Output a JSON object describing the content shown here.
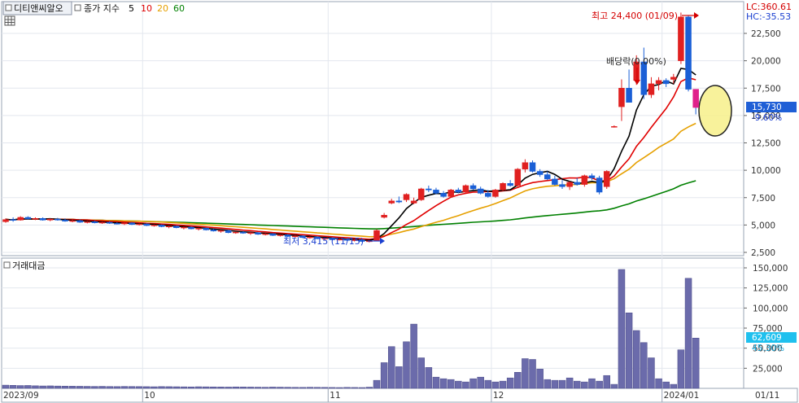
{
  "header": {
    "stock_name": "디티앤씨알오",
    "legend_prefix": "종가 지수",
    "ma_periods": [
      {
        "label": "5",
        "color": "#000000"
      },
      {
        "label": "10",
        "color": "#e00000"
      },
      {
        "label": "20",
        "color": "#e6a000"
      },
      {
        "label": "60",
        "color": "#008000"
      }
    ],
    "lc_text": "LC:360.61",
    "hc_text": "HC:-35.53",
    "volume_panel_title": "거래대금"
  },
  "chart_data": {
    "type": "candlestick",
    "price_panel": {
      "yticks": [
        "22,500",
        "20,000",
        "17,500",
        "15,000",
        "12,500",
        "10,000",
        "7,500",
        "5,000",
        "2,500"
      ],
      "ylim": [
        1500,
        26000
      ],
      "last_price_label": "15,730",
      "last_change_label": "-9.60%",
      "annotations": {
        "high": "최고 24,400 (01/09)",
        "low": "최저 3,415 (11/15)",
        "dividend": "배당락(0.00%)"
      },
      "candles": [
        [
          5300,
          5600,
          5200,
          5500
        ],
        [
          5500,
          5700,
          5300,
          5450
        ],
        [
          5450,
          5800,
          5400,
          5700
        ],
        [
          5700,
          5800,
          5500,
          5550
        ],
        [
          5550,
          5700,
          5450,
          5600
        ],
        [
          5600,
          5700,
          5400,
          5450
        ],
        [
          5450,
          5600,
          5350,
          5550
        ],
        [
          5550,
          5650,
          5400,
          5450
        ],
        [
          5450,
          5600,
          5300,
          5350
        ],
        [
          5350,
          5500,
          5250,
          5400
        ],
        [
          5400,
          5500,
          5200,
          5250
        ],
        [
          5250,
          5350,
          5150,
          5300
        ],
        [
          5300,
          5400,
          5150,
          5200
        ],
        [
          5200,
          5300,
          5100,
          5250
        ],
        [
          5250,
          5350,
          5100,
          5150
        ],
        [
          5150,
          5250,
          5050,
          5100
        ],
        [
          5100,
          5250,
          5000,
          5200
        ],
        [
          5200,
          5250,
          5000,
          5050
        ],
        [
          5050,
          5150,
          4950,
          5100
        ],
        [
          5100,
          5150,
          4900,
          4950
        ],
        [
          4950,
          5050,
          4850,
          5000
        ],
        [
          5000,
          5050,
          4800,
          4850
        ],
        [
          4850,
          4950,
          4700,
          4900
        ],
        [
          4900,
          4950,
          4700,
          4750
        ],
        [
          4750,
          4850,
          4600,
          4800
        ],
        [
          4800,
          4850,
          4600,
          4650
        ],
        [
          4650,
          4750,
          4500,
          4700
        ],
        [
          4700,
          4750,
          4500,
          4550
        ],
        [
          4550,
          4650,
          4400,
          4450
        ],
        [
          4450,
          4550,
          4300,
          4500
        ],
        [
          4500,
          4550,
          4250,
          4300
        ],
        [
          4300,
          4400,
          4200,
          4350
        ],
        [
          4350,
          4450,
          4200,
          4250
        ],
        [
          4250,
          4350,
          4100,
          4300
        ],
        [
          4300,
          4350,
          4100,
          4150
        ],
        [
          4150,
          4250,
          4050,
          4200
        ],
        [
          4200,
          4250,
          4000,
          4050
        ],
        [
          4050,
          4150,
          3950,
          4100
        ],
        [
          4100,
          4150,
          3900,
          3950
        ],
        [
          3950,
          4050,
          3850,
          4000
        ],
        [
          4000,
          4050,
          3800,
          3850
        ],
        [
          3850,
          3950,
          3750,
          3900
        ],
        [
          3900,
          3950,
          3700,
          3750
        ],
        [
          3750,
          3850,
          3650,
          3800
        ],
        [
          3800,
          3850,
          3600,
          3650
        ],
        [
          3650,
          3750,
          3600,
          3700
        ],
        [
          3700,
          3750,
          3550,
          3600
        ],
        [
          3600,
          3700,
          3500,
          3650
        ],
        [
          3650,
          3700,
          3450,
          3500
        ],
        [
          3500,
          3600,
          3415,
          3550
        ],
        [
          3550,
          4600,
          3500,
          4500
        ],
        [
          5700,
          6100,
          5600,
          5900
        ],
        [
          7000,
          7400,
          6900,
          7200
        ],
        [
          7200,
          7600,
          7000,
          7100
        ],
        [
          7300,
          7900,
          7100,
          7800
        ],
        [
          7000,
          7500,
          6900,
          7200
        ],
        [
          7300,
          8400,
          7200,
          8300
        ],
        [
          8300,
          8600,
          8000,
          8200
        ],
        [
          8200,
          8400,
          7800,
          7900
        ],
        [
          7900,
          8100,
          7500,
          7600
        ],
        [
          7600,
          8300,
          7500,
          8200
        ],
        [
          8200,
          8400,
          7900,
          8000
        ],
        [
          8000,
          8700,
          7900,
          8600
        ],
        [
          8600,
          8800,
          8200,
          8300
        ],
        [
          8300,
          8500,
          7800,
          7900
        ],
        [
          7900,
          8200,
          7500,
          7600
        ],
        [
          7600,
          8300,
          7500,
          8200
        ],
        [
          8200,
          8900,
          8100,
          8800
        ],
        [
          8800,
          9100,
          8500,
          8600
        ],
        [
          8600,
          10200,
          8500,
          10100
        ],
        [
          10100,
          11000,
          9800,
          10700
        ],
        [
          10700,
          10900,
          9800,
          9900
        ],
        [
          9900,
          10100,
          9400,
          9600
        ],
        [
          9600,
          9900,
          9100,
          9200
        ],
        [
          9200,
          9500,
          8600,
          8700
        ],
        [
          8700,
          9100,
          8300,
          8500
        ],
        [
          8500,
          9000,
          8200,
          8900
        ],
        [
          8900,
          9300,
          8600,
          8700
        ],
        [
          8700,
          9600,
          8500,
          9500
        ],
        [
          9500,
          9700,
          9100,
          9300
        ],
        [
          9300,
          9500,
          7800,
          8000
        ],
        [
          8500,
          10000,
          8300,
          9900
        ],
        [
          14000,
          14100,
          13900,
          14000
        ],
        [
          15800,
          18300,
          14500,
          17500
        ],
        [
          17500,
          19200,
          17000,
          16200
        ],
        [
          18200,
          20500,
          17800,
          19900
        ],
        [
          19900,
          21200,
          16500,
          16900
        ],
        [
          16900,
          18500,
          16600,
          17900
        ],
        [
          17900,
          18500,
          17300,
          18200
        ],
        [
          18200,
          18400,
          17600,
          17900
        ],
        [
          18300,
          18800,
          17900,
          18500
        ],
        [
          20000,
          24400,
          19700,
          24000
        ],
        [
          24000,
          24100,
          17200,
          17400
        ],
        [
          17400,
          17400,
          15100,
          15730
        ]
      ]
    },
    "volume_panel": {
      "yticks": [
        "150,000",
        "125,000",
        "100,000",
        "75,000",
        "50,000",
        "25,000"
      ],
      "ylim": [
        0,
        160000
      ],
      "last_volume_label": "62,609",
      "last_volume_change_label": "45.30%",
      "values": [
        4000,
        3800,
        3500,
        3600,
        3200,
        3000,
        3100,
        2900,
        2800,
        2700,
        2600,
        2500,
        2400,
        2500,
        2300,
        2200,
        2400,
        2300,
        2200,
        2100,
        2000,
        2200,
        2100,
        2000,
        1900,
        1800,
        2000,
        1900,
        1800,
        1700,
        1600,
        1800,
        1700,
        1600,
        1500,
        1400,
        1600,
        1500,
        1400,
        1300,
        1200,
        1400,
        1300,
        1200,
        1100,
        1000,
        1200,
        1100,
        1000,
        1500,
        10000,
        32000,
        52000,
        27000,
        58000,
        80000,
        38000,
        26000,
        14000,
        12000,
        11000,
        9000,
        8000,
        12000,
        14000,
        10000,
        8000,
        9000,
        13000,
        20000,
        37000,
        36000,
        24000,
        11000,
        10000,
        10000,
        13000,
        9000,
        8000,
        12000,
        9000,
        16000,
        5000,
        148000,
        94000,
        72000,
        57000,
        38000,
        12000,
        8000,
        5000,
        48000,
        137000,
        62609
      ]
    },
    "x_axis_labels": [
      {
        "label": "2023/09",
        "index": 0
      },
      {
        "label": "10",
        "index": 19
      },
      {
        "label": "11",
        "index": 44
      },
      {
        "label": "12",
        "index": 66
      },
      {
        "label": "2024/01",
        "index": 89
      },
      {
        "label": "01/11",
        "index": 99
      }
    ],
    "colors": {
      "up": "#e02020",
      "down": "#1a5fd6",
      "ma5": "#000000",
      "ma10": "#e00000",
      "ma20": "#e6a000",
      "ma60": "#008000",
      "volume_bar": "#6b6bab",
      "last_price_box": "#1f5fd6",
      "last_volume_box": "#1fc0ee",
      "highlight_circle": "#f7f08a"
    }
  }
}
